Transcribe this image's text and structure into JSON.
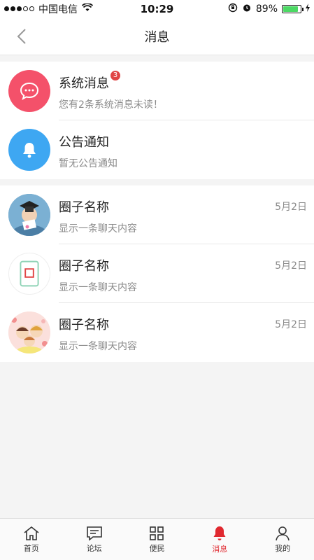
{
  "status_bar": {
    "carrier": "中国电信",
    "time": "10:29",
    "battery_percent": "89%",
    "battery_level": 0.89
  },
  "nav": {
    "title": "消息",
    "back_icon": "chevron-left-icon"
  },
  "system_items": [
    {
      "title": "系统消息",
      "badge": "3",
      "subtitle": "您有2条系统消息未读！",
      "icon": "chat-bubble-icon",
      "color": "#f4516a"
    },
    {
      "title": "公告通知",
      "subtitle": "暂无公告通知",
      "icon": "bell-icon",
      "color": "#3ea7f2"
    }
  ],
  "groups": [
    {
      "name": "圈子名称",
      "date": "5月2日",
      "preview": "显示一条聊天内容"
    },
    {
      "name": "圈子名称",
      "date": "5月2日",
      "preview": "显示一条聊天内容"
    },
    {
      "name": "圈子名称",
      "date": "5月2日",
      "preview": "显示一条聊天内容"
    }
  ],
  "tabs": [
    {
      "label": "首页",
      "icon": "home-icon",
      "active": false
    },
    {
      "label": "论坛",
      "icon": "message-board-icon",
      "active": false
    },
    {
      "label": "便民",
      "icon": "grid-icon",
      "active": false
    },
    {
      "label": "消息",
      "icon": "bell-icon",
      "active": true
    },
    {
      "label": "我的",
      "icon": "person-icon",
      "active": false
    }
  ],
  "colors": {
    "accent": "#e0282f",
    "badge": "#e04545"
  }
}
